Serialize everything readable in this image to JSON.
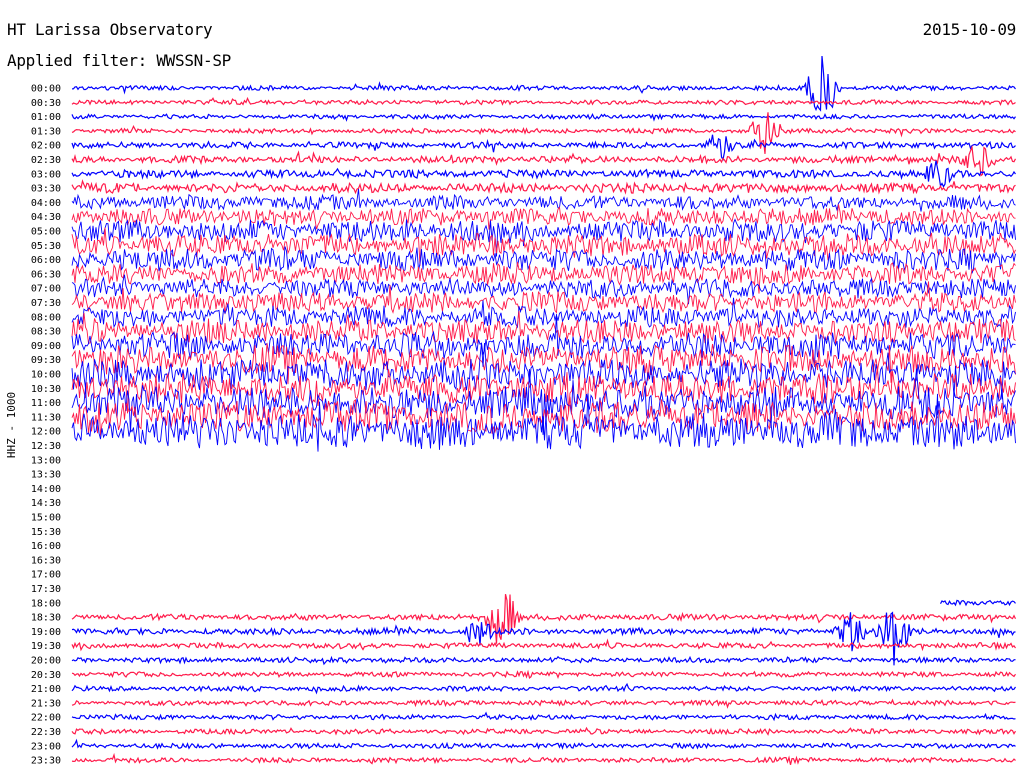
{
  "header": {
    "title": "HT Larissa Observatory",
    "date": "2015-10-09",
    "filter_label": "Applied filter: WWSSN-SP"
  },
  "colors": {
    "trace_a": "#0000ff",
    "trace_b": "#ff1a4a"
  },
  "chart_data": {
    "type": "line",
    "ylabel": "HHZ - 1000",
    "rows": [
      {
        "time": "00:00",
        "has_data": true,
        "level": 0.05
      },
      {
        "time": "00:30",
        "has_data": true,
        "level": 0.05
      },
      {
        "time": "01:00",
        "has_data": true,
        "level": 0.05
      },
      {
        "time": "01:30",
        "has_data": true,
        "level": 0.05
      },
      {
        "time": "02:00",
        "has_data": true,
        "level": 0.1
      },
      {
        "time": "02:30",
        "has_data": true,
        "level": 0.12
      },
      {
        "time": "03:00",
        "has_data": true,
        "level": 0.15
      },
      {
        "time": "03:30",
        "has_data": true,
        "level": 0.2
      },
      {
        "time": "04:00",
        "has_data": true,
        "level": 0.35
      },
      {
        "time": "04:30",
        "has_data": true,
        "level": 0.45
      },
      {
        "time": "05:00",
        "has_data": true,
        "level": 0.6
      },
      {
        "time": "05:30",
        "has_data": true,
        "level": 0.6
      },
      {
        "time": "06:00",
        "has_data": true,
        "level": 0.6
      },
      {
        "time": "06:30",
        "has_data": true,
        "level": 0.55
      },
      {
        "time": "07:00",
        "has_data": true,
        "level": 0.5
      },
      {
        "time": "07:30",
        "has_data": true,
        "level": 0.55
      },
      {
        "time": "08:00",
        "has_data": true,
        "level": 0.55
      },
      {
        "time": "08:30",
        "has_data": true,
        "level": 0.65
      },
      {
        "time": "09:00",
        "has_data": true,
        "level": 0.75
      },
      {
        "time": "09:30",
        "has_data": true,
        "level": 0.8
      },
      {
        "time": "10:00",
        "has_data": true,
        "level": 0.85
      },
      {
        "time": "10:30",
        "has_data": true,
        "level": 0.85
      },
      {
        "time": "11:00",
        "has_data": true,
        "level": 0.9
      },
      {
        "time": "11:30",
        "has_data": true,
        "level": 0.9
      },
      {
        "time": "12:00",
        "has_data": true,
        "level": 1.0
      },
      {
        "time": "12:30",
        "has_data": false,
        "level": 0
      },
      {
        "time": "13:00",
        "has_data": false,
        "level": 0
      },
      {
        "time": "13:30",
        "has_data": false,
        "level": 0
      },
      {
        "time": "14:00",
        "has_data": false,
        "level": 0
      },
      {
        "time": "14:30",
        "has_data": false,
        "level": 0
      },
      {
        "time": "15:00",
        "has_data": false,
        "level": 0
      },
      {
        "time": "15:30",
        "has_data": false,
        "level": 0
      },
      {
        "time": "16:00",
        "has_data": false,
        "level": 0
      },
      {
        "time": "16:30",
        "has_data": false,
        "level": 0
      },
      {
        "time": "17:00",
        "has_data": false,
        "level": 0
      },
      {
        "time": "17:30",
        "has_data": false,
        "level": 0
      },
      {
        "time": "18:00",
        "has_data": true,
        "level": 0.06,
        "data_start_fraction": 0.92
      },
      {
        "time": "18:30",
        "has_data": true,
        "level": 0.1
      },
      {
        "time": "19:00",
        "has_data": true,
        "level": 0.1
      },
      {
        "time": "19:30",
        "has_data": true,
        "level": 0.08
      },
      {
        "time": "20:00",
        "has_data": true,
        "level": 0.07
      },
      {
        "time": "20:30",
        "has_data": true,
        "level": 0.06
      },
      {
        "time": "21:00",
        "has_data": true,
        "level": 0.06
      },
      {
        "time": "21:30",
        "has_data": true,
        "level": 0.06
      },
      {
        "time": "22:00",
        "has_data": true,
        "level": 0.06
      },
      {
        "time": "22:30",
        "has_data": true,
        "level": 0.06
      },
      {
        "time": "23:00",
        "has_data": true,
        "level": 0.06
      },
      {
        "time": "23:30",
        "has_data": true,
        "level": 0.06
      }
    ],
    "events": [
      {
        "time": "00:00",
        "position": 0.795,
        "amplitude": 1.0
      },
      {
        "time": "02:00",
        "position": 0.685,
        "amplitude": 0.4
      },
      {
        "time": "01:30",
        "position": 0.735,
        "amplitude": 0.6
      },
      {
        "time": "02:30",
        "position": 0.96,
        "amplitude": 0.4
      },
      {
        "time": "03:00",
        "position": 0.92,
        "amplitude": 0.35
      },
      {
        "time": "18:30",
        "position": 0.455,
        "amplitude": 1.0
      },
      {
        "time": "19:00",
        "position": 0.87,
        "amplitude": 0.9
      },
      {
        "time": "19:00",
        "position": 0.825,
        "amplitude": 0.5
      },
      {
        "time": "19:00",
        "position": 0.43,
        "amplitude": 0.4
      }
    ],
    "grid": false,
    "legend": "none"
  }
}
